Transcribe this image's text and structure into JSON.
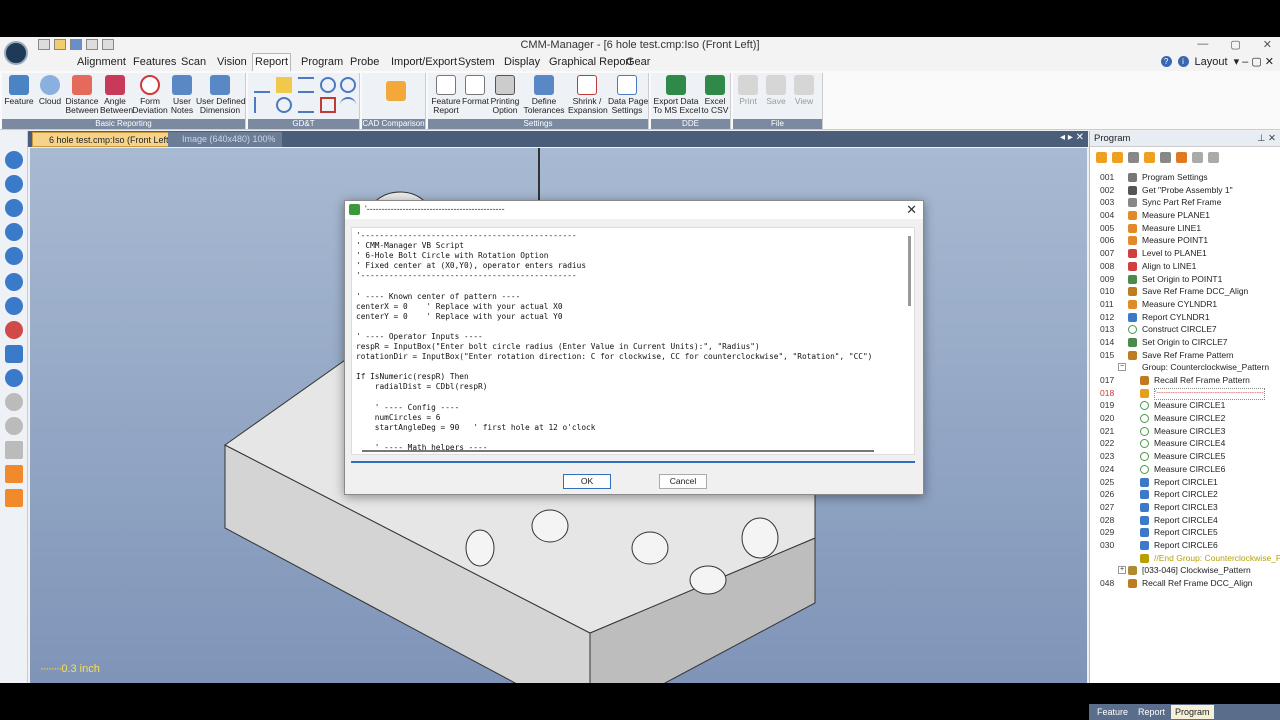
{
  "window": {
    "title": "CMM-Manager - [6 hole test.cmp:Iso (Front Left)]",
    "controls": [
      "—",
      "▢",
      "✕"
    ]
  },
  "ribbon_tabs": [
    "Alignment",
    "Features",
    "Scan",
    "Vision",
    "Report",
    "Program",
    "Probe",
    "Import/Export",
    "System",
    "Display",
    "Graphical Report",
    "Gear"
  ],
  "active_tab": "Report",
  "layout_label": "Layout",
  "ribbon_groups": {
    "basic_reporting": {
      "label": "Basic Reporting",
      "buttons": [
        {
          "label": "Feature",
          "icon": "feature-report-icon"
        },
        {
          "label": "Cloud",
          "icon": "cloud-icon"
        },
        {
          "label": "Distance\nBetween",
          "icon": "distance-between-icon"
        },
        {
          "label": "Angle\nBetween",
          "icon": "angle-between-icon"
        },
        {
          "label": "Form\nDeviation",
          "icon": "form-deviation-icon"
        },
        {
          "label": "User\nNotes",
          "icon": "user-notes-icon"
        },
        {
          "label": "User Defined\nDimension",
          "icon": "user-defined-dimension-icon"
        }
      ]
    },
    "gdt": {
      "label": "GD&T"
    },
    "cad_comparison": {
      "label": "CAD Comparison"
    },
    "settings": {
      "label": "Settings",
      "buttons": [
        {
          "label": "Feature\nReport",
          "icon": "feature-report-settings-icon"
        },
        {
          "label": "Format",
          "icon": "format-icon"
        },
        {
          "label": "Printing\nOption",
          "icon": "printing-option-icon"
        },
        {
          "label": "Define\nTolerances",
          "icon": "define-tolerances-icon"
        },
        {
          "label": "Shrink /\nExpansion",
          "icon": "shrink-expansion-icon"
        },
        {
          "label": "Data Page\nSettings",
          "icon": "data-page-settings-icon"
        }
      ]
    },
    "dde": {
      "label": "DDE",
      "buttons": [
        {
          "label": "Export Data\nTo MS Excel",
          "icon": "export-excel-icon"
        },
        {
          "label": "Excel\nto CSV",
          "icon": "excel-csv-icon"
        }
      ]
    },
    "file": {
      "label": "File",
      "buttons": [
        {
          "label": "Print",
          "icon": "print-icon"
        },
        {
          "label": "Save",
          "icon": "save-icon"
        },
        {
          "label": "View",
          "icon": "view-icon"
        }
      ]
    }
  },
  "doc_tabs": {
    "active": "6 hole test.cmp:Iso (Front Left)",
    "second": "Image (640x480) 100%"
  },
  "viewport": {
    "scale_label": "0.3 inch"
  },
  "program_panel": {
    "title": "Program",
    "rows": [
      {
        "num": "001",
        "label": "Program Settings",
        "icon": "settings-wrench-icon",
        "indent": 0
      },
      {
        "num": "002",
        "label": "Get \"Probe Assembly 1\"",
        "icon": "probe-icon",
        "indent": 0
      },
      {
        "num": "003",
        "label": "Sync Part Ref Frame",
        "icon": "sync-frame-icon",
        "indent": 0
      },
      {
        "num": "004",
        "label": "Measure PLANE1",
        "icon": "plane-icon",
        "indent": 0
      },
      {
        "num": "005",
        "label": "Measure LINE1",
        "icon": "line-icon",
        "indent": 0
      },
      {
        "num": "006",
        "label": "Measure POINT1",
        "icon": "point-icon",
        "indent": 0
      },
      {
        "num": "007",
        "label": "Level to PLANE1",
        "icon": "level-icon",
        "indent": 0
      },
      {
        "num": "008",
        "label": "Align to LINE1",
        "icon": "align-icon",
        "indent": 0
      },
      {
        "num": "009",
        "label": "Set Origin to POINT1",
        "icon": "origin-icon",
        "indent": 0
      },
      {
        "num": "010",
        "label": "Save Ref Frame DCC_Align",
        "icon": "save-frame-icon",
        "indent": 0
      },
      {
        "num": "011",
        "label": "Measure CYLNDR1",
        "icon": "cylinder-icon",
        "indent": 0
      },
      {
        "num": "012",
        "label": "Report CYLNDR1",
        "icon": "report-icon",
        "indent": 0
      },
      {
        "num": "013",
        "label": "Construct CIRCLE7",
        "icon": "circle-icon",
        "indent": 0
      },
      {
        "num": "014",
        "label": "Set Origin to CIRCLE7",
        "icon": "origin-icon",
        "indent": 0
      },
      {
        "num": "015",
        "label": "Save Ref Frame Pattern",
        "icon": "save-frame-icon",
        "indent": 0
      },
      {
        "num": "",
        "label": "Group: Counterclockwise_Pattern",
        "icon": "",
        "indent": 0,
        "expander": "−"
      },
      {
        "num": "017",
        "label": "Recall Ref Frame Pattern",
        "icon": "recall-frame-icon",
        "indent": 1
      },
      {
        "num": "018",
        "label": "'----------------------------------------------",
        "icon": "script-icon",
        "indent": 1,
        "selected": true
      },
      {
        "num": "019",
        "label": "Measure CIRCLE1",
        "icon": "circle-icon",
        "indent": 1
      },
      {
        "num": "020",
        "label": "Measure CIRCLE2",
        "icon": "circle-icon",
        "indent": 1
      },
      {
        "num": "021",
        "label": "Measure CIRCLE3",
        "icon": "circle-icon",
        "indent": 1
      },
      {
        "num": "022",
        "label": "Measure CIRCLE4",
        "icon": "circle-icon",
        "indent": 1
      },
      {
        "num": "023",
        "label": "Measure CIRCLE5",
        "icon": "circle-icon",
        "indent": 1
      },
      {
        "num": "024",
        "label": "Measure CIRCLE6",
        "icon": "circle-icon",
        "indent": 1
      },
      {
        "num": "025",
        "label": "Report CIRCLE1",
        "icon": "report-icon",
        "indent": 1
      },
      {
        "num": "026",
        "label": "Report CIRCLE2",
        "icon": "report-icon",
        "indent": 1
      },
      {
        "num": "027",
        "label": "Report CIRCLE3",
        "icon": "report-icon",
        "indent": 1
      },
      {
        "num": "028",
        "label": "Report CIRCLE4",
        "icon": "report-icon",
        "indent": 1
      },
      {
        "num": "029",
        "label": "Report CIRCLE5",
        "icon": "report-icon",
        "indent": 1
      },
      {
        "num": "030",
        "label": "Report CIRCLE6",
        "icon": "report-icon",
        "indent": 1
      },
      {
        "num": "",
        "label": "//End Group: Counterclockwise_Patt...",
        "icon": "end-group-icon",
        "indent": 1,
        "endgroup": true
      },
      {
        "num": "",
        "label": "[033-046] Clockwise_Pattern",
        "icon": "group-icon",
        "indent": 0,
        "expander": "+"
      },
      {
        "num": "048",
        "label": "Recall Ref Frame DCC_Align",
        "icon": "recall-frame-icon",
        "indent": 0
      }
    ],
    "bottom_tabs": [
      "Feature",
      "Report",
      "Program"
    ],
    "active_bottom_tab": "Program"
  },
  "dialog": {
    "title": "'----------------------------------------------",
    "code": "'----------------------------------------------\n' CMM-Manager VB Script\n' 6-Hole Bolt Circle with Rotation Option\n' Fixed center at (X0,Y0), operator enters radius\n'----------------------------------------------\n\n' ---- Known center of pattern ----\ncenterX = 0    ' Replace with your actual X0\ncenterY = 0    ' Replace with your actual Y0\n\n' ---- Operator Inputs ----\nrespR = InputBox(\"Enter bolt circle radius (Enter Value in Current Units):\", \"Radius\")\nrotationDir = InputBox(\"Enter rotation direction: C for clockwise, CC for counterclockwise\", \"Rotation\", \"CC\")\n\nIf IsNumeric(respR) Then\n    radialDist = CDbl(respR)\n\n    ' ---- Config ----\n    numCircles = 6\n    startAngleDeg = 90   ' first hole at 12 o'clock\n\n    ' ---- Math helpers ----",
    "ok_label": "OK",
    "cancel_label": "Cancel"
  },
  "colors": {
    "accent": "#2f6fbd",
    "active_doc_tab": "#f6d38a",
    "viewport_top": "#a8bad2",
    "viewport_bottom": "#7f94b8",
    "scale_label": "#f5e050",
    "group_bar": "#7b8aa0"
  }
}
